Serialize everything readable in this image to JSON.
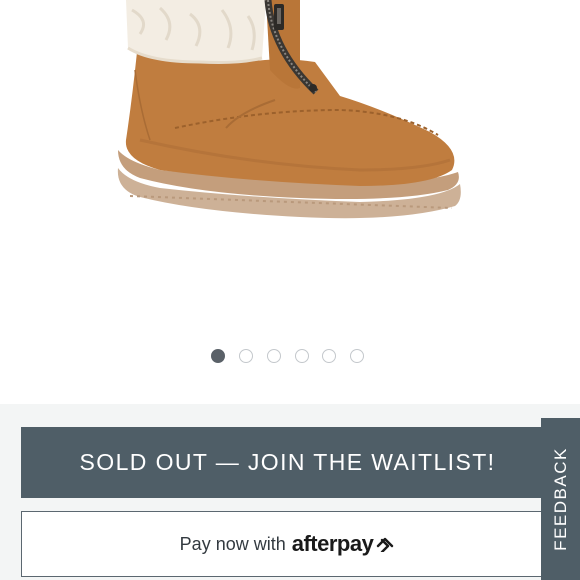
{
  "product": {
    "image_name": "suede-zip-boot-with-shearling-cuff"
  },
  "carousel": {
    "total_slides": 6,
    "active_index": 0
  },
  "actions": {
    "waitlist_label": "SOLD OUT — JOIN THE WAITLIST!",
    "pay_prefix": "Pay now with",
    "pay_brand": "afterpay"
  },
  "feedback": {
    "label": "FEEDBACK"
  },
  "colors": {
    "slate_accent": "#4f5e67",
    "panel_background": "#f3f5f5",
    "suede_tan": "#c07d3f",
    "sole_beige": "#c9a98c",
    "shearling_cream": "#f3ede3",
    "active_dot": "#5a6168",
    "inactive_dot_border": "#c4c8cc"
  },
  "icons": [
    "afterpay-logo-icon",
    "zipper-icon"
  ]
}
